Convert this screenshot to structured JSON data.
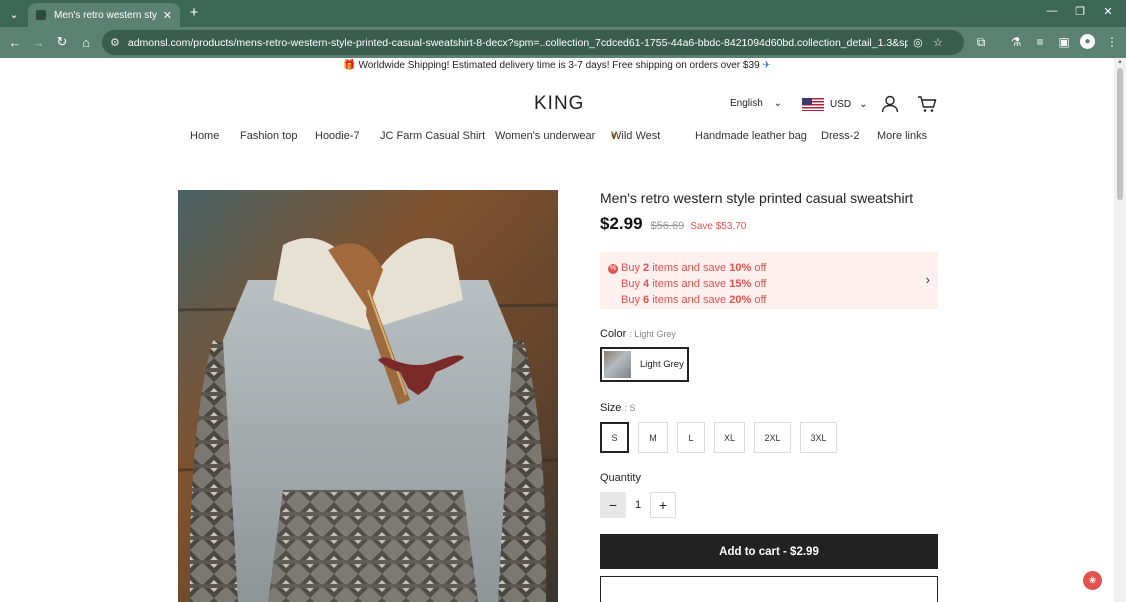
{
  "browser": {
    "tab_title": "Men's retro western style printe",
    "url": "admonsl.com/products/mens-retro-western-style-printed-casual-sweatshirt-8-decx?spm=..collection_7cdced61-1755-44a6-bbdc-8421094d60bd.collection_detail_1.3&spm_prev=..index.header..."
  },
  "announcement": {
    "text": "Worldwide Shipping! Estimated delivery time is 3-7 days! Free shipping on orders over $39"
  },
  "header": {
    "logo": "KING",
    "language": "English",
    "currency": "USD"
  },
  "nav": {
    "items": [
      "Home",
      "Fashion top",
      "Hoodie-7",
      "JC Farm Casual Shirt",
      "Women's underwear",
      "Wild West",
      "Handmade leather bag",
      "Dress-2",
      "More links"
    ]
  },
  "product": {
    "title": "Men's retro western style printed casual sweatshirt",
    "price": "$2.99",
    "compare_price": "$56.69",
    "save": "Save $53.70",
    "promo": [
      {
        "pre": "Buy ",
        "qty": "2",
        "mid": " items and save ",
        "pct": "10%",
        "post": " off"
      },
      {
        "pre": "Buy ",
        "qty": "4",
        "mid": " items and save ",
        "pct": "15%",
        "post": " off"
      },
      {
        "pre": "Buy ",
        "qty": "6",
        "mid": " items and save ",
        "pct": "20%",
        "post": " off"
      }
    ],
    "color_label": "Color",
    "color_selected": ": Light Grey",
    "color_option": "Light Grey",
    "size_label": "Size",
    "size_selected": ": S",
    "sizes": [
      "S",
      "M",
      "L",
      "XL",
      "2XL",
      "3XL"
    ],
    "quantity_label": "Quantity",
    "quantity": "1",
    "add_to_cart": "Add to cart  -  $2.99"
  },
  "colors": {
    "chrome": "#5a8171",
    "accent_red": "#e2534f",
    "button_dark": "#222222"
  }
}
